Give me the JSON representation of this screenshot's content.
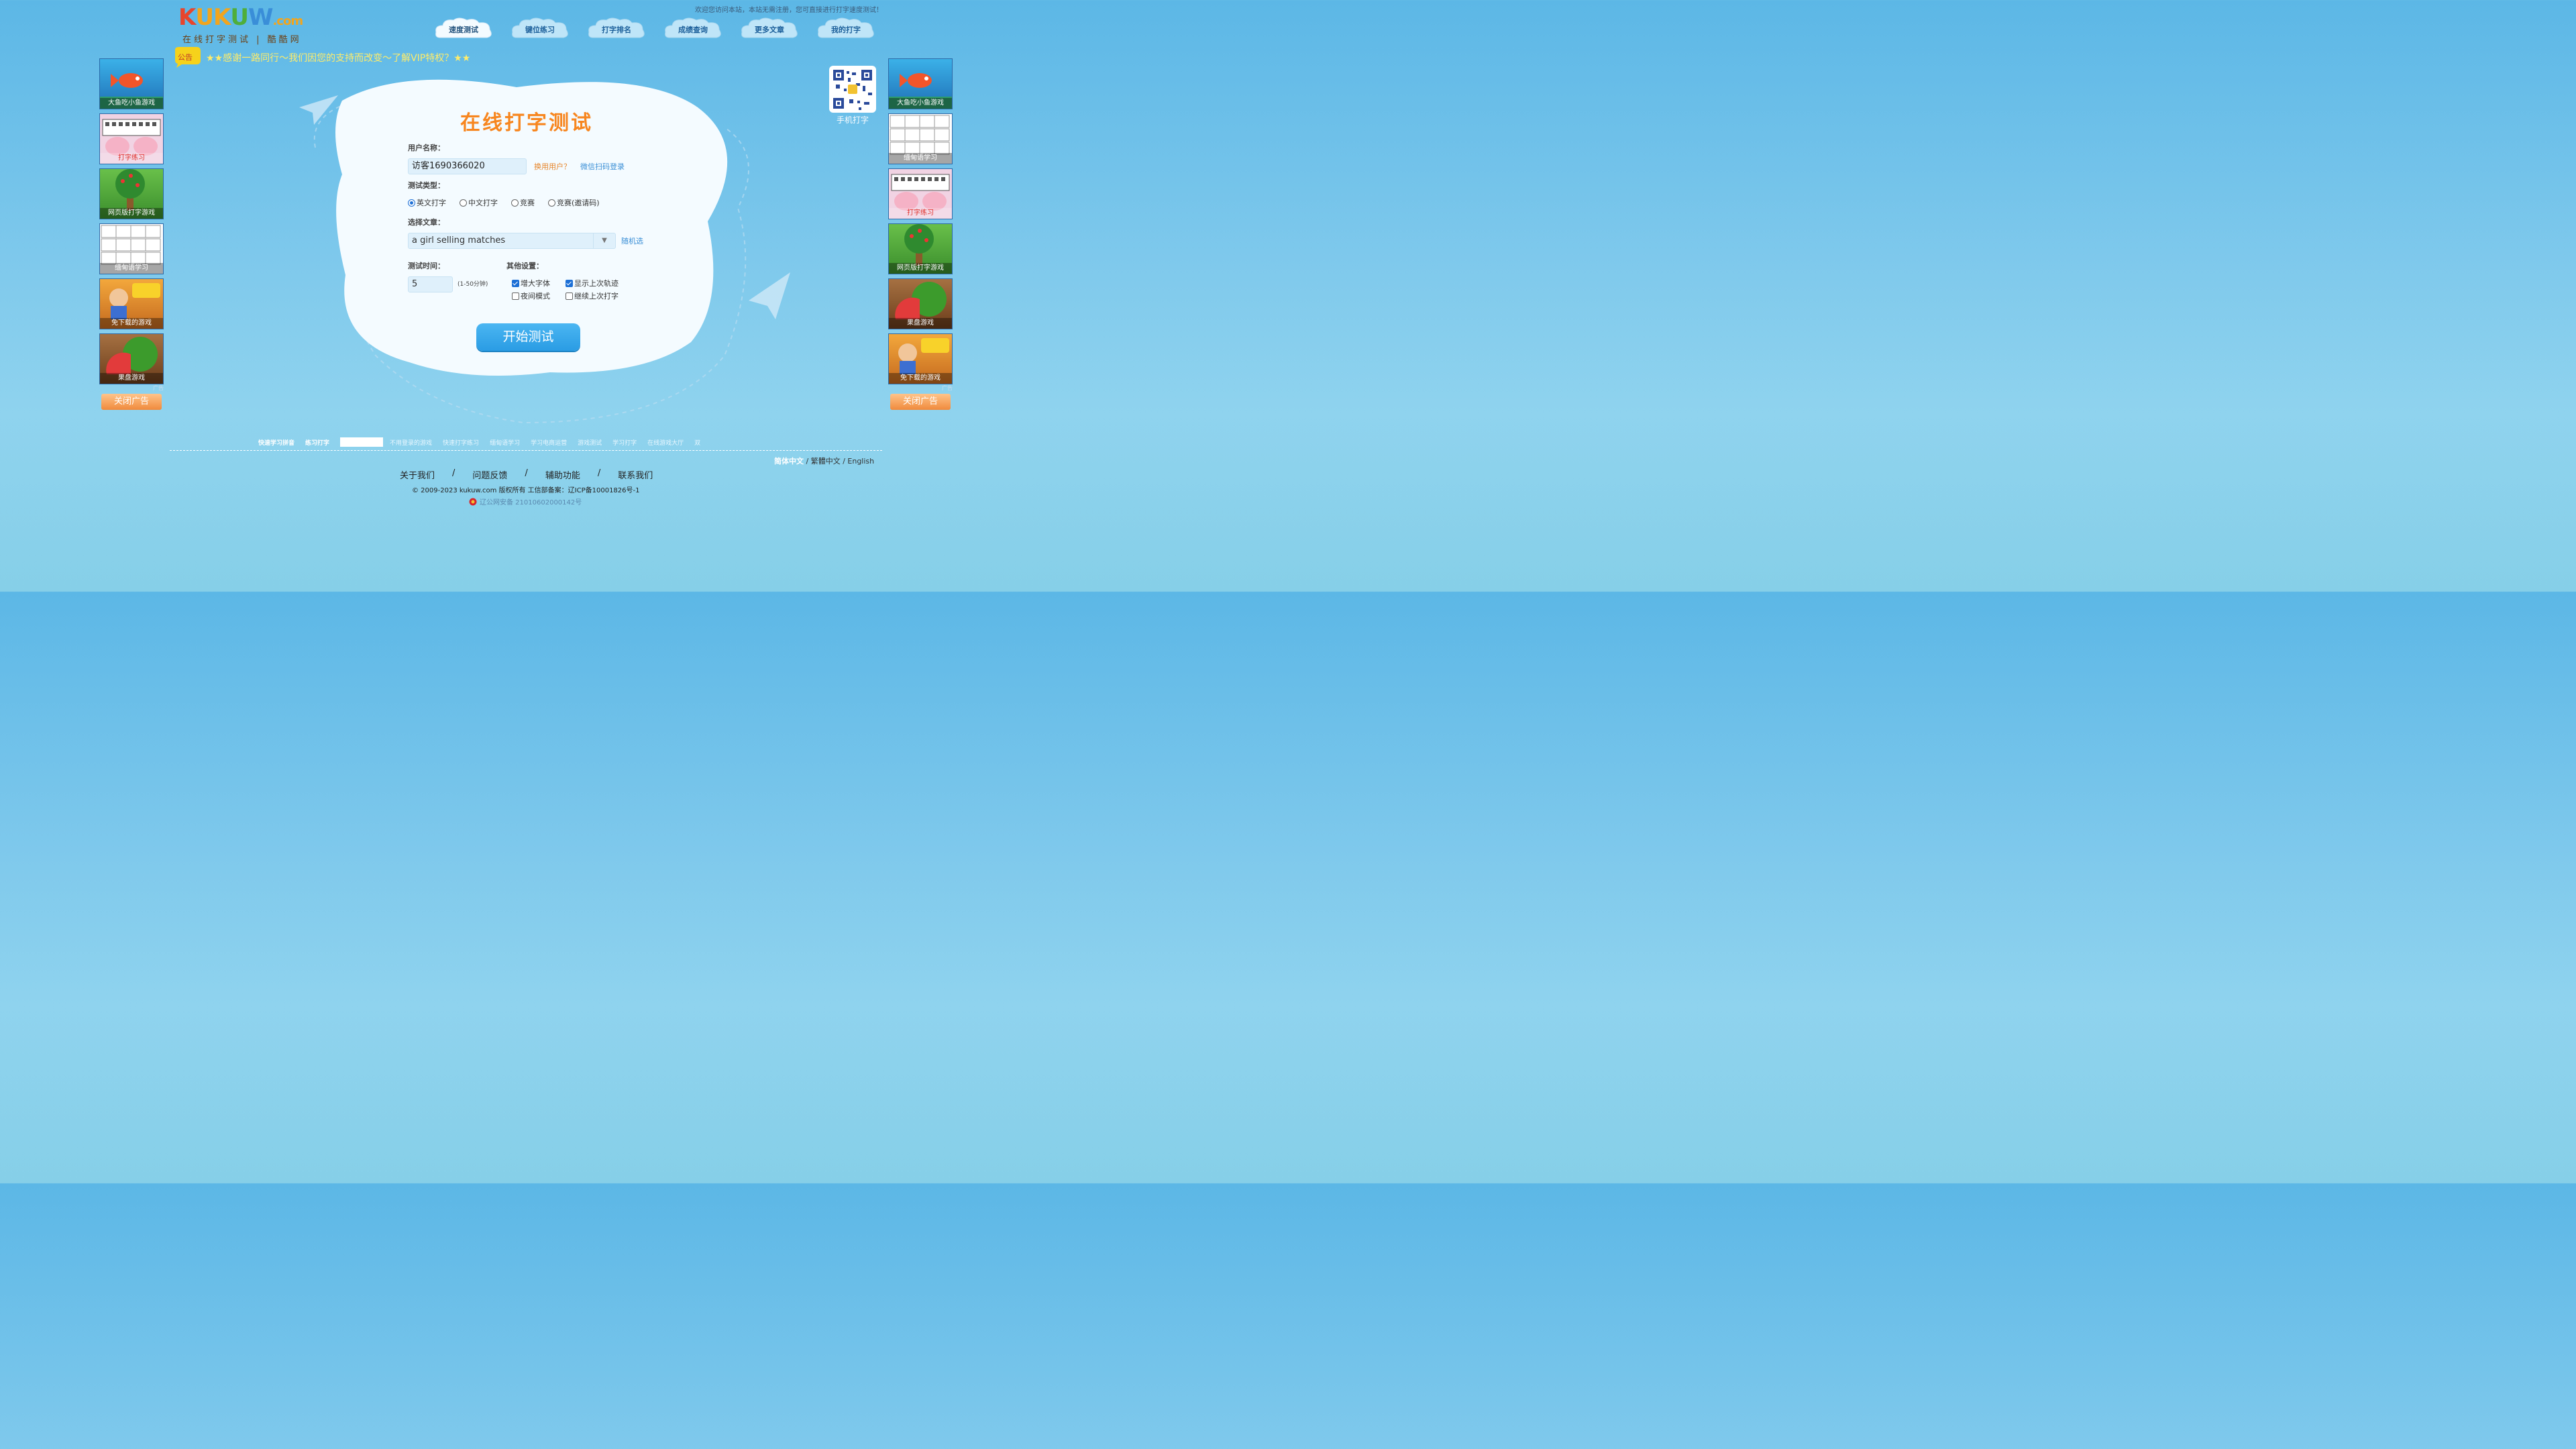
{
  "header": {
    "logo_text": "KUKUW.com",
    "logo_sub": "在线打字测试 | 酷酷网",
    "welcome": "欢迎您访问本站，本站无需注册，您可直接进行打字速度测试！",
    "nav": [
      "速度测试",
      "键位练习",
      "打字排名",
      "成绩查询",
      "更多文章",
      "我的打字"
    ],
    "notice_badge": "公告",
    "notice_text": "★★感谢一路同行～我们因您的支持而改变～了解VIP特权？★★"
  },
  "ads_left": [
    {
      "caption": "大鱼吃小鱼游戏",
      "icon": "fish-game-icon"
    },
    {
      "caption": "打字练习",
      "icon": "keyboard-hands-icon"
    },
    {
      "caption": "网页版打字游戏",
      "icon": "apple-tree-icon"
    },
    {
      "caption": "缅甸语学习",
      "icon": "myanmar-keyboard-icon"
    },
    {
      "caption": "免下载的游戏",
      "icon": "subway-surfers-icon"
    },
    {
      "caption": "果盘游戏",
      "icon": "watermelon-icon"
    }
  ],
  "ads_right": [
    {
      "caption": "大鱼吃小鱼游戏",
      "icon": "fish-game-icon"
    },
    {
      "caption": "缅甸语学习",
      "icon": "myanmar-keyboard-icon"
    },
    {
      "caption": "打字练习",
      "icon": "keyboard-hands-icon"
    },
    {
      "caption": "网页版打字游戏",
      "icon": "apple-tree-icon"
    },
    {
      "caption": "果盘游戏",
      "icon": "watermelon-icon"
    },
    {
      "caption": "免下载的游戏",
      "icon": "subway-surfers-icon"
    }
  ],
  "ad_mark": "广告",
  "close_ad": "关闭广告",
  "qr_label": "手机打字",
  "form": {
    "title": "在线打字测试",
    "username_label": "用户名称：",
    "username_value": "访客1690366020",
    "switch_user": "换用用户？",
    "wechat_login": "微信扫码登录",
    "test_type_label": "测试类型：",
    "test_types": [
      {
        "label": "英文打字",
        "checked": true
      },
      {
        "label": "中文打字",
        "checked": false
      },
      {
        "label": "竞赛",
        "checked": false
      },
      {
        "label": "竞赛(邀请码)",
        "checked": false
      }
    ],
    "article_label": "选择文章：",
    "article_value": "a girl selling matches",
    "random_pick": "随机选",
    "time_label": "测试时间：",
    "time_value": "5",
    "time_hint": "(1-50分钟)",
    "other_label": "其他设置：",
    "options": [
      {
        "label": "增大字体",
        "checked": true
      },
      {
        "label": "显示上次轨迹",
        "checked": true
      },
      {
        "label": "夜间模式",
        "checked": false
      },
      {
        "label": "继续上次打字",
        "checked": false
      }
    ],
    "start_button": "开始测试"
  },
  "footer": {
    "quick_links": [
      "快速学习拼音",
      "练习打字",
      "不用登录的游戏",
      "快速打字练习",
      "缅甸语学习",
      "学习电商运营",
      "游戏测试",
      "学习打字",
      "在线游戏大厅",
      "双"
    ],
    "lang_current": "简体中文",
    "lang_others": " / 繁體中文 / English",
    "links": [
      "关于我们",
      "/",
      "问题反馈",
      "/",
      "辅助功能",
      "/",
      "联系我们"
    ],
    "copyright": "© 2009-2023 kukuw.com 版权所有 工信部备案：辽ICP备10001826号-1",
    "beian": "辽公网安备 21010602000142号"
  }
}
